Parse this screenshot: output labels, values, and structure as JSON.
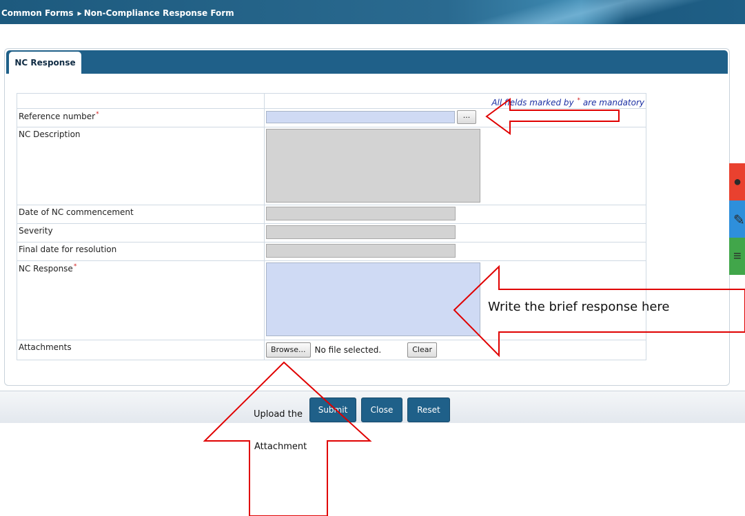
{
  "breadcrumb": {
    "root": "Common Forms",
    "current": "Non-Compliance Response Form"
  },
  "tab": {
    "label": "NC Response"
  },
  "form": {
    "mandatory_note": "All fields marked by",
    "mandatory_suffix": "are mandatory",
    "required_mark": "*",
    "fields": {
      "reference_number": "Reference number",
      "nc_description": "NC Description",
      "date_of_commencement": "Date of NC commencement",
      "severity": "Severity",
      "final_date": "Final date for resolution",
      "nc_response": "NC Response",
      "attachments": "Attachments"
    },
    "lookup_button": "...",
    "browse_button": "Browse...",
    "no_file": "No file selected.",
    "clear_button": "Clear"
  },
  "actions": {
    "submit": "Submit",
    "close": "Close",
    "reset": "Reset"
  },
  "annotations": {
    "response_hint": "Write the brief response here",
    "upload_line1": "Upload the",
    "upload_line2": "Attachment"
  },
  "colors": {
    "header_blue": "#1f6089",
    "required_red": "#d21b1b",
    "mandatory_note_blue": "#1b2fa3",
    "editable_field": "#cfdaf4",
    "readonly_field": "#d3d3d3",
    "annotation_red": "#e00000",
    "side_red": "#e9412f",
    "side_blue": "#2e8fdb",
    "side_green": "#41a64a"
  },
  "side_widgets": [
    "lightbulb-icon",
    "pencil-icon",
    "list-icon"
  ]
}
